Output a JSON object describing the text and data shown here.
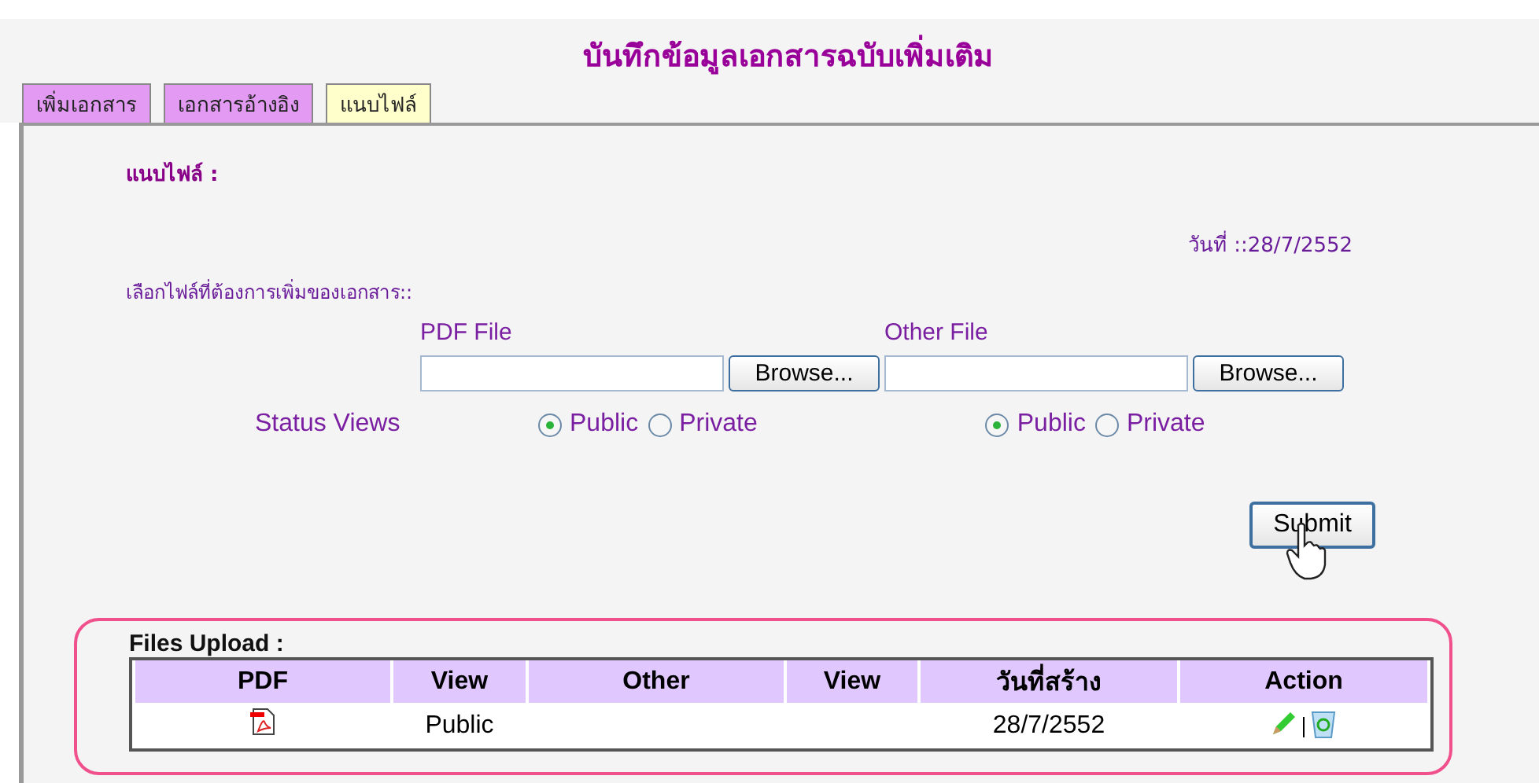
{
  "title": "บันทึกข้อมูลเอกสารฉบับเพิ่มเติม",
  "tabs": [
    {
      "label": "เพิ่มเอกสาร",
      "selected": false
    },
    {
      "label": "เอกสารอ้างอิง",
      "selected": false
    },
    {
      "label": "แนบไฟล์",
      "selected": true
    }
  ],
  "section_heading": "แนบไฟล์ :",
  "date": "วันที่ ::28/7/2552",
  "choose_label": "เลือกไฟล์ที่ต้องการเพิ่มของเอกสาร::",
  "uploads": [
    {
      "label": "PDF File",
      "browse": "Browse...",
      "options": [
        {
          "label": "Public",
          "selected": true
        },
        {
          "label": "Private",
          "selected": false
        }
      ]
    },
    {
      "label": "Other File",
      "browse": "Browse...",
      "options": [
        {
          "label": "Public",
          "selected": true
        },
        {
          "label": "Private",
          "selected": false
        }
      ]
    }
  ],
  "status_label": "Status Views",
  "submit": "Submit",
  "files_heading": "Files Upload :",
  "table": {
    "columns": [
      "PDF",
      "View",
      "Other",
      "View",
      "วันที่สร้าง",
      "Action"
    ],
    "rows": [
      {
        "has_pdf": true,
        "view": "Public",
        "date": "28/7/2552"
      }
    ]
  }
}
